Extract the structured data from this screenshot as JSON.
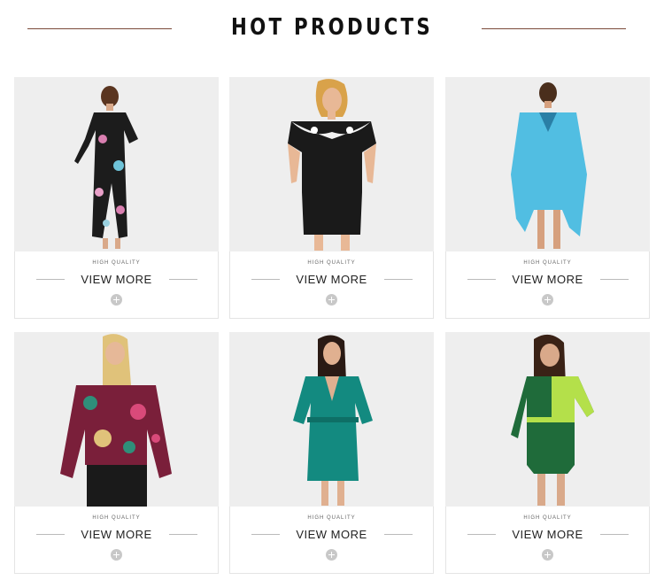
{
  "header": {
    "title": "HOT PRODUCTS"
  },
  "products": [
    {
      "quality": "HIGH QUALITY",
      "cta": "VIEW MORE",
      "image": "floral-kimono-robe-photo"
    },
    {
      "quality": "HIGH QUALITY",
      "cta": "VIEW MORE",
      "image": "black-lace-dress-photo"
    },
    {
      "quality": "HIGH QUALITY",
      "cta": "VIEW MORE",
      "image": "blue-cover-up-dress-photo"
    },
    {
      "quality": "HIGH QUALITY",
      "cta": "VIEW MORE",
      "image": "sequin-bomber-jacket-photo"
    },
    {
      "quality": "HIGH QUALITY",
      "cta": "VIEW MORE",
      "image": "teal-satin-robe-photo"
    },
    {
      "quality": "HIGH QUALITY",
      "cta": "VIEW MORE",
      "image": "green-wrap-dress-photo"
    }
  ],
  "colors": {
    "accent_line": "#7a4a3a",
    "photo_bg": "#eeeeee",
    "plus_icon": "#c8c8c8"
  }
}
